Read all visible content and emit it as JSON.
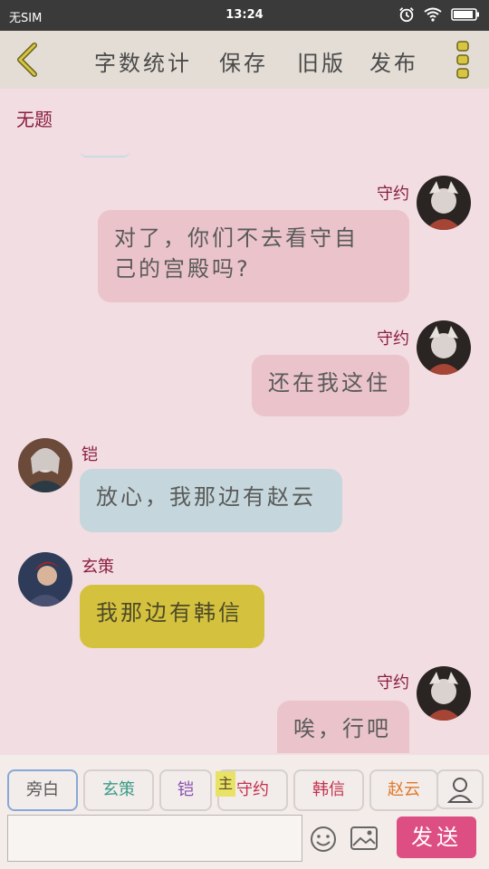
{
  "status_bar": {
    "carrier": "无SIM",
    "time": "13:24"
  },
  "toolbar": {
    "word_count": "字数统计",
    "save": "保存",
    "old_version": "旧版",
    "publish": "发布"
  },
  "story": {
    "title": "无题"
  },
  "messages": [
    {
      "speaker": "守约",
      "text_lines": [
        "对了，你们不去看守自",
        "己的宫殿吗?"
      ],
      "side": "right",
      "bubble_color": "#ebc4cb"
    },
    {
      "speaker": "守约",
      "text_lines": [
        "还在我这住"
      ],
      "side": "right",
      "bubble_color": "#ebc4cb"
    },
    {
      "speaker": "铠",
      "text_lines": [
        "放心，我那边有赵云"
      ],
      "side": "left",
      "bubble_color": "#c5d7dc"
    },
    {
      "speaker": "玄策",
      "text_lines": [
        "我那边有韩信"
      ],
      "side": "left",
      "bubble_color": "#d4c23f"
    },
    {
      "speaker": "守约",
      "text_lines": [
        "唉，行吧"
      ],
      "side": "right",
      "bubble_color": "#ebc4cb"
    }
  ],
  "roles": [
    {
      "label": "旁白",
      "color": "#5a5a5a"
    },
    {
      "label": "玄策",
      "color": "#3a9a88"
    },
    {
      "label": "铠",
      "color": "#8a4fb0"
    },
    {
      "label": "守约",
      "color": "#c4324e"
    },
    {
      "label": "韩信",
      "color": "#c4324e"
    },
    {
      "label": "赵云",
      "color": "#e07a2a"
    }
  ],
  "main_tag": "主",
  "send_button": "发送",
  "colors": {
    "accent": "#dd4e82",
    "name": "#8a1e3e"
  }
}
